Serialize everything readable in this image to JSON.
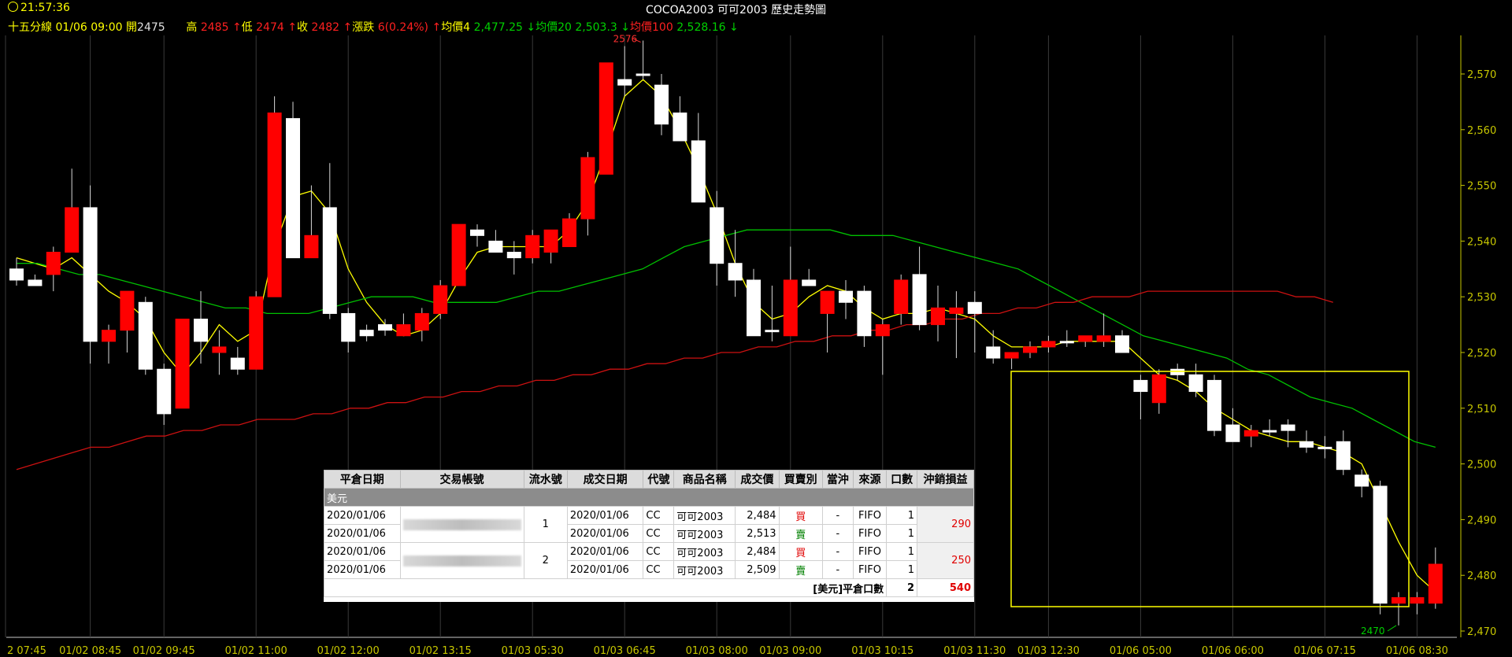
{
  "title_bar": {
    "time": "21:57:36",
    "title": "COCOA2003 可可2003  歷史走勢圖"
  },
  "info_line": {
    "period": "十五分線 01/06 09:00",
    "open_label": "開",
    "open": "2475",
    "high_label": "高",
    "high": "2485",
    "low_label": "低",
    "low": "2474",
    "close_label": "收",
    "close": "2482",
    "change_label": "漲跌",
    "change": "6(0.24%)",
    "ma4_label": "均價4",
    "ma4": "2,477.25",
    "ma20_label": "均價20",
    "ma20": "2,503.3",
    "ma100_label": "均價100",
    "ma100": "2,528.16",
    "up_arrow": "↑",
    "down_arrow": "↓"
  },
  "colors": {
    "up": "#ff0000",
    "down": "#ffffff",
    "ma4": "#ffff00",
    "ma20": "#00c000",
    "ma100": "#cc1111",
    "axis": "#c8c800",
    "box": "#ffff00"
  },
  "chart_data": {
    "type": "candlestick",
    "ylim": [
      2468,
      2578
    ],
    "y_ticks": [
      "2,470",
      "2,480",
      "2,490",
      "2,500",
      "2,510",
      "2,520",
      "2,530",
      "2,540",
      "2,550",
      "2,560",
      "2,570"
    ],
    "y_tick_values": [
      2470,
      2480,
      2490,
      2500,
      2510,
      2520,
      2530,
      2540,
      2550,
      2560,
      2570
    ],
    "x_tick_labels": [
      "2 07:45",
      "01/02 08:45",
      "01/02 09:45",
      "01/02 11:00",
      "01/02 12:00",
      "01/02 13:15",
      "01/03 05:30",
      "01/03 06:45",
      "01/03 08:00",
      "01/03 09:00",
      "01/03 10:15",
      "01/03 11:30",
      "01/03 12:30",
      "01/06 05:00",
      "01/06 06:00",
      "01/06 07:15",
      "01/06 08:30"
    ],
    "x_tick_bar_index": [
      0,
      4,
      8,
      13,
      18,
      23,
      28,
      33,
      38,
      42,
      47,
      52,
      56,
      61,
      66,
      71,
      76
    ],
    "candles": [
      [
        2535,
        2537,
        2532,
        2533
      ],
      [
        2533,
        2534,
        2532,
        2532
      ],
      [
        2534,
        2539,
        2531,
        2538
      ],
      [
        2538,
        2553,
        2538,
        2546
      ],
      [
        2546,
        2550,
        2518,
        2522
      ],
      [
        2522,
        2525,
        2518,
        2524
      ],
      [
        2524,
        2531,
        2520,
        2531
      ],
      [
        2529,
        2530,
        2516,
        2517
      ],
      [
        2517,
        2518,
        2507,
        2509
      ],
      [
        2510,
        2526,
        2510,
        2526
      ],
      [
        2526,
        2531,
        2518,
        2522
      ],
      [
        2520,
        2524,
        2516,
        2521
      ],
      [
        2519,
        2521,
        2516,
        2517
      ],
      [
        2517,
        2531,
        2517,
        2530
      ],
      [
        2530,
        2566,
        2530,
        2563
      ],
      [
        2562,
        2565,
        2538,
        2537
      ],
      [
        2537,
        2550,
        2537,
        2541
      ],
      [
        2546,
        2554,
        2526,
        2527
      ],
      [
        2527,
        2528,
        2520,
        2522
      ],
      [
        2524,
        2525,
        2522,
        2523
      ],
      [
        2525,
        2526,
        2523,
        2524
      ],
      [
        2523,
        2527,
        2523,
        2525
      ],
      [
        2524,
        2528,
        2522,
        2527
      ],
      [
        2527,
        2533,
        2526,
        2532
      ],
      [
        2532,
        2543,
        2532,
        2543
      ],
      [
        2542,
        2543,
        2539,
        2541
      ],
      [
        2540,
        2542,
        2538,
        2538
      ],
      [
        2538,
        2540,
        2534,
        2537
      ],
      [
        2537,
        2542,
        2536,
        2541
      ],
      [
        2538,
        2542,
        2536,
        2542
      ],
      [
        2539,
        2545,
        2539,
        2544
      ],
      [
        2544,
        2556,
        2541,
        2555
      ],
      [
        2552,
        2572,
        2552,
        2572
      ],
      [
        2569,
        2575,
        2566,
        2568
      ],
      [
        2570,
        2576,
        2569,
        2570
      ],
      [
        2568,
        2570,
        2559,
        2561
      ],
      [
        2563,
        2566,
        2559,
        2558
      ],
      [
        2558,
        2563,
        2547,
        2547
      ],
      [
        2546,
        2549,
        2532,
        2536
      ],
      [
        2536,
        2542,
        2530,
        2533
      ],
      [
        2533,
        2535,
        2523,
        2523
      ],
      [
        2524,
        2532,
        2522,
        2524
      ],
      [
        2523,
        2539,
        2524,
        2533
      ],
      [
        2533,
        2535,
        2532,
        2532
      ],
      [
        2527,
        2531,
        2520,
        2531
      ],
      [
        2531,
        2533,
        2526,
        2529
      ],
      [
        2531,
        2532,
        2521,
        2523
      ],
      [
        2523,
        2526,
        2516,
        2525
      ],
      [
        2527,
        2534,
        2525,
        2533
      ],
      [
        2534,
        2539,
        2524,
        2525
      ],
      [
        2525,
        2532,
        2522,
        2528
      ],
      [
        2527,
        2531,
        2519,
        2528
      ],
      [
        2529,
        2531,
        2520,
        2527
      ],
      [
        2521,
        2524,
        2518,
        2519
      ],
      [
        2519,
        2520,
        2517,
        2520
      ],
      [
        2520,
        2522,
        2519,
        2521
      ],
      [
        2521,
        2523,
        2520,
        2522
      ],
      [
        2522,
        2524,
        2521,
        2522
      ],
      [
        2522,
        2523,
        2521,
        2523
      ],
      [
        2522,
        2527,
        2521,
        2523
      ],
      [
        2523,
        2524,
        2520,
        2520
      ],
      [
        2515,
        2516,
        2508,
        2513
      ],
      [
        2511,
        2517,
        2509,
        2516
      ],
      [
        2517,
        2518,
        2515,
        2516
      ],
      [
        2516,
        2518,
        2512,
        2513
      ],
      [
        2515,
        2516,
        2505,
        2506
      ],
      [
        2507,
        2510,
        2504,
        2504
      ],
      [
        2505,
        2507,
        2503,
        2506
      ],
      [
        2506,
        2508,
        2505,
        2506
      ],
      [
        2507,
        2508,
        2503,
        2506
      ],
      [
        2504,
        2506,
        2502,
        2503
      ],
      [
        2503,
        2505,
        2501,
        2503
      ],
      [
        2504,
        2506,
        2498,
        2499
      ],
      [
        2498,
        2499,
        2494,
        2496
      ],
      [
        2496,
        2497,
        2473,
        2475
      ],
      [
        2475,
        2477,
        2471,
        2476
      ],
      [
        2475,
        2477,
        2473,
        2476
      ],
      [
        2475,
        2485,
        2474,
        2482
      ]
    ],
    "series": [
      {
        "name": "均價4",
        "values": [
          2537,
          2536,
          2535,
          2537,
          2534,
          2531,
          2529,
          2526,
          2520,
          2516,
          2520,
          2525,
          2522,
          2524,
          2539,
          2548,
          2549,
          2545,
          2535,
          2529,
          2525,
          2523,
          2524,
          2527,
          2533,
          2538,
          2539,
          2539,
          2539,
          2539,
          2542,
          2547,
          2556,
          2566,
          2569,
          2566,
          2560,
          2553,
          2545,
          2536,
          2529,
          2526,
          2527,
          2530,
          2532,
          2531,
          2528,
          2526,
          2527,
          2527,
          2528,
          2527,
          2526,
          2523,
          2521,
          2521,
          2521,
          2522,
          2522,
          2522,
          2522,
          2519,
          2516,
          2515,
          2513,
          2510,
          2508,
          2506,
          2505,
          2504,
          2504,
          2503,
          2502,
          2500,
          2493,
          2486,
          2480,
          2477
        ]
      },
      {
        "name": "均價20",
        "values": [
          2536,
          2536,
          2535,
          2534,
          2534,
          2533,
          2532,
          2531,
          2530,
          2529,
          2528,
          2528,
          2527,
          2527,
          2527,
          2528,
          2529,
          2530,
          2530,
          2530,
          2529,
          2529,
          2529,
          2529,
          2530,
          2531,
          2531,
          2532,
          2533,
          2534,
          2535,
          2537,
          2539,
          2540,
          2541,
          2542,
          2542,
          2542,
          2542,
          2542,
          2541,
          2541,
          2541,
          2540,
          2539,
          2538,
          2537,
          2536,
          2535,
          2533,
          2531,
          2529,
          2527,
          2525,
          2523,
          2522,
          2521,
          2520,
          2519,
          2517,
          2516,
          2514,
          2512,
          2511,
          2510,
          2508,
          2506,
          2504,
          2503
        ]
      },
      {
        "name": "均價100",
        "values": [
          2499,
          2500,
          2501,
          2502,
          2503,
          2503,
          2504,
          2505,
          2505,
          2506,
          2506,
          2507,
          2507,
          2508,
          2508,
          2508,
          2509,
          2509,
          2510,
          2510,
          2511,
          2511,
          2512,
          2512,
          2513,
          2513,
          2514,
          2514,
          2515,
          2515,
          2516,
          2516,
          2517,
          2517,
          2518,
          2518,
          2519,
          2519,
          2520,
          2520,
          2521,
          2521,
          2522,
          2522,
          2523,
          2523,
          2524,
          2524,
          2525,
          2525,
          2526,
          2526,
          2527,
          2527,
          2528,
          2528,
          2529,
          2529,
          2530,
          2530,
          2530,
          2531,
          2531,
          2531,
          2531,
          2531,
          2531,
          2531,
          2531,
          2530,
          2530,
          2529
        ]
      }
    ],
    "annotations": {
      "max_label": "2576",
      "min_label": "2470"
    }
  },
  "trade_table": {
    "headers": [
      "平倉日期",
      "交易帳號",
      "流水號",
      "成交日期",
      "代號",
      "商品名稱",
      "成交價",
      "買賣別",
      "當沖",
      "來源",
      "口數",
      "沖銷損益"
    ],
    "group_label": "美元",
    "rows": [
      {
        "close_date": "2020/01/06",
        "seq": "1",
        "trade_date": "2020/01/06",
        "code": "CC",
        "name": "可可2003",
        "price": "2,484",
        "side": "買",
        "daytrade": "-",
        "source": "FIFO",
        "qty": "1"
      },
      {
        "close_date": "2020/01/06",
        "trade_date": "2020/01/06",
        "code": "CC",
        "name": "可可2003",
        "price": "2,513",
        "side": "賣",
        "daytrade": "-",
        "source": "FIFO",
        "qty": "1"
      },
      {
        "close_date": "2020/01/06",
        "seq": "2",
        "trade_date": "2020/01/06",
        "code": "CC",
        "name": "可可2003",
        "price": "2,484",
        "side": "買",
        "daytrade": "-",
        "source": "FIFO",
        "qty": "1"
      },
      {
        "close_date": "2020/01/06",
        "trade_date": "2020/01/06",
        "code": "CC",
        "name": "可可2003",
        "price": "2,509",
        "side": "賣",
        "daytrade": "-",
        "source": "FIFO",
        "qty": "1"
      }
    ],
    "pnl": [
      "290",
      "250"
    ],
    "summary_label": "[美元]平倉口數",
    "summary_qty": "2",
    "summary_pnl": "540"
  }
}
